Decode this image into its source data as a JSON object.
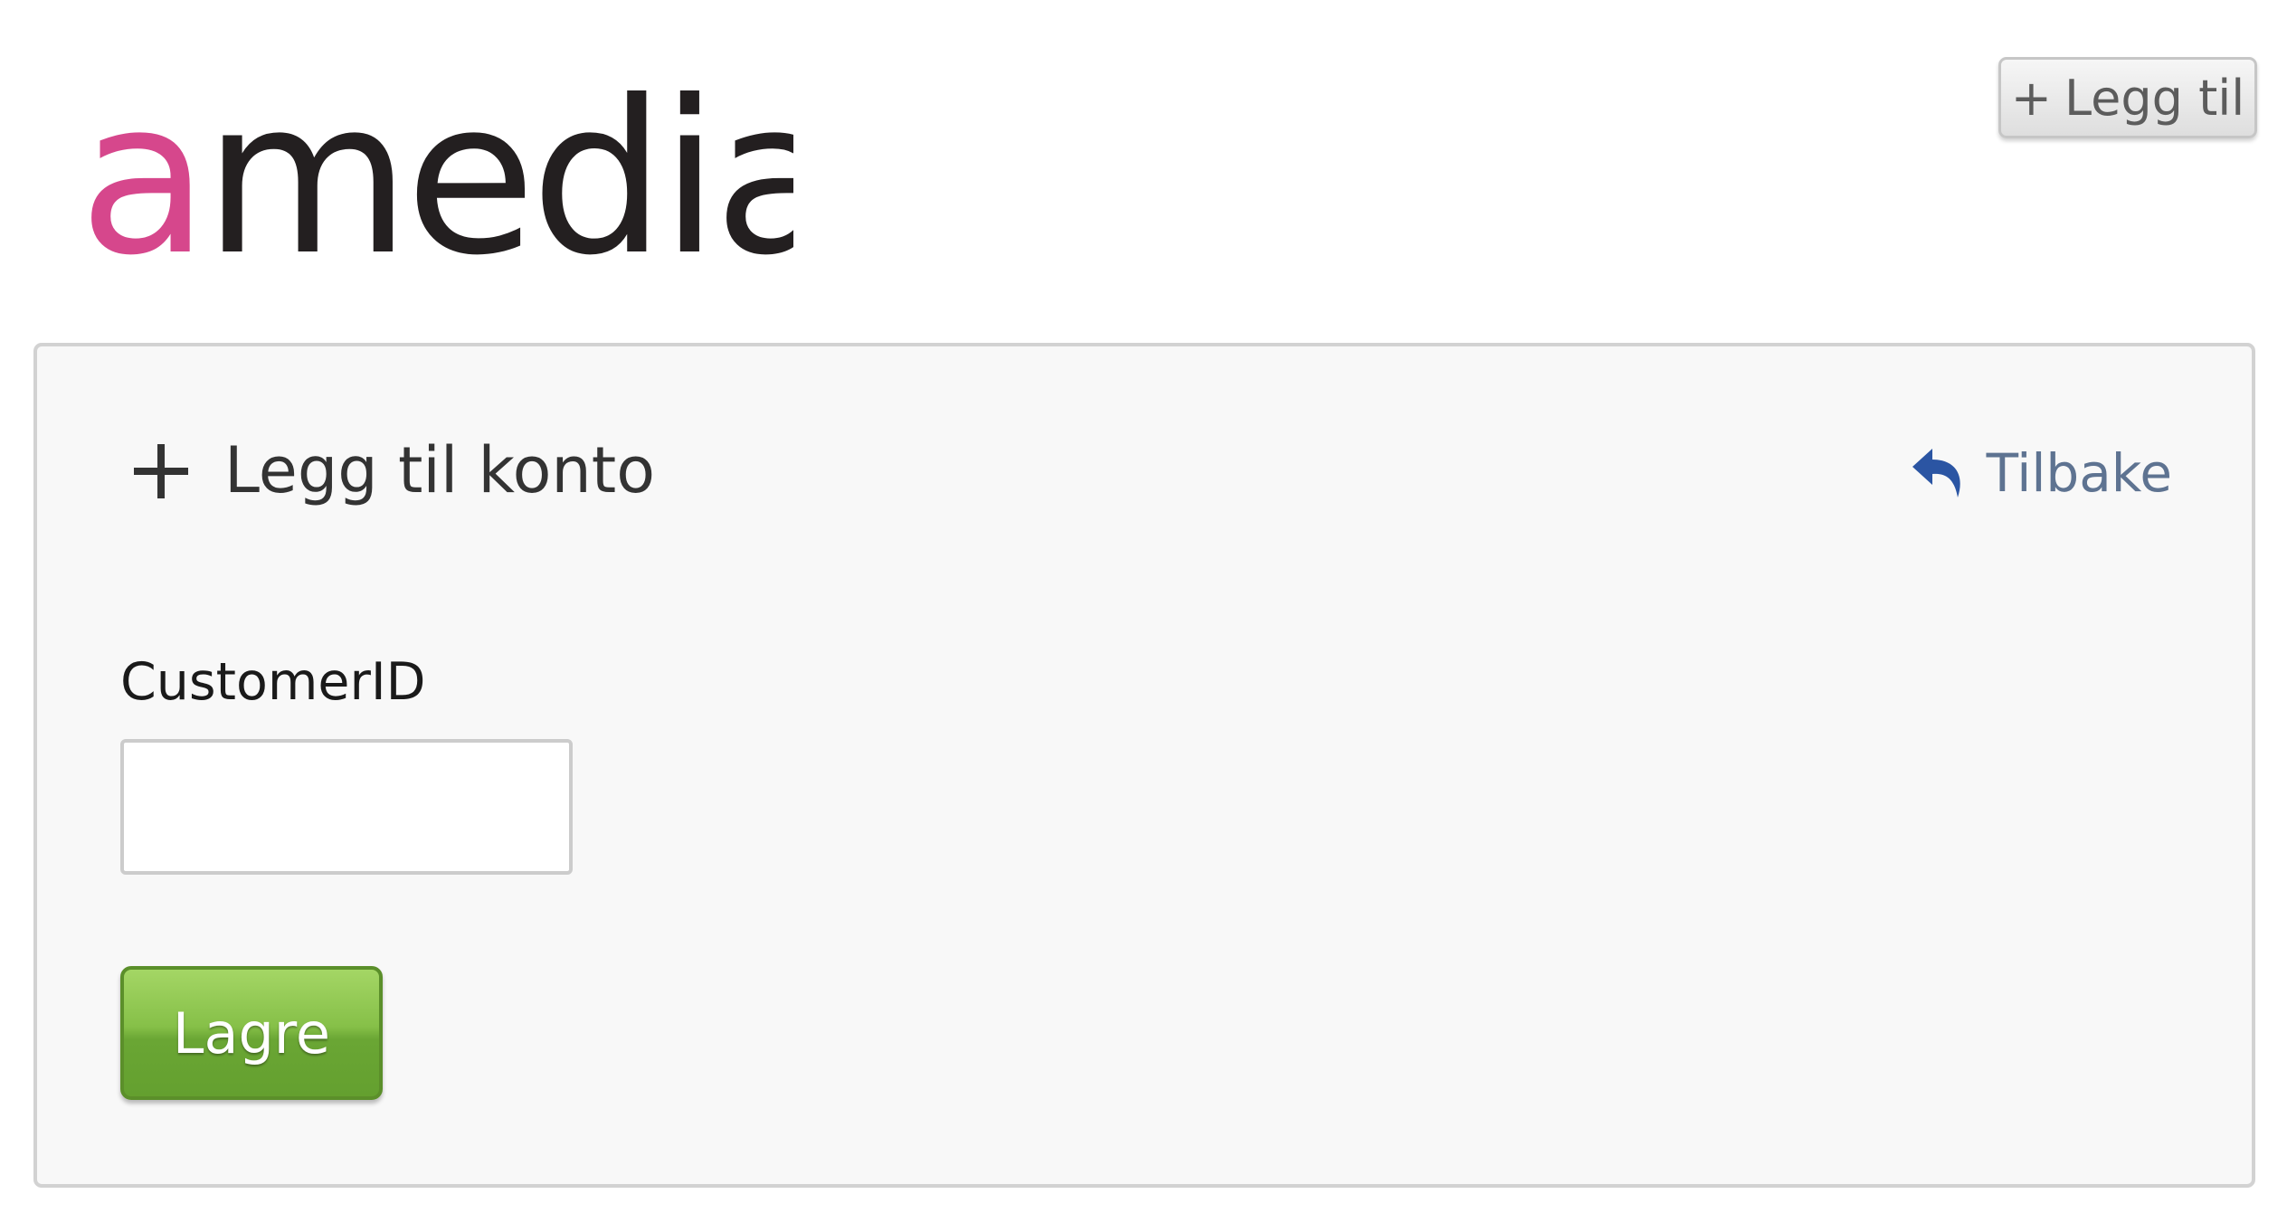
{
  "header": {
    "logo": {
      "text": "amedia",
      "accent_color": "#d6478c",
      "text_color": "#231f20"
    },
    "add_button": {
      "icon": "plus-icon",
      "plus_glyph": "+",
      "label": "Legg til"
    }
  },
  "panel": {
    "title": {
      "icon": "plus-icon",
      "label": "Legg til konto"
    },
    "back_link": {
      "icon": "reply-arrow-icon",
      "label": "Tilbake",
      "icon_color": "#2b55a3",
      "text_color": "#5e7391"
    },
    "form": {
      "customer_id": {
        "label": "CustomerID",
        "value": ""
      },
      "save_button": {
        "label": "Lagre",
        "color": "#77b33e"
      }
    }
  }
}
